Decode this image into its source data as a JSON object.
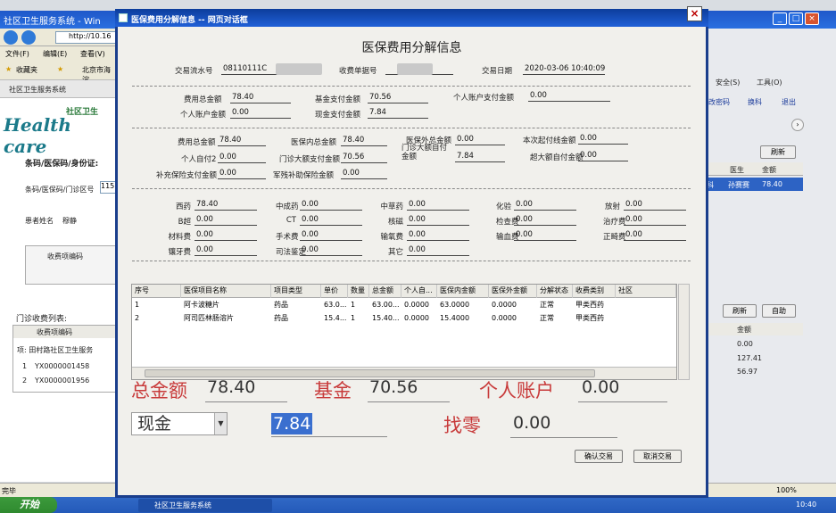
{
  "background": {
    "tab_title": "社区卫生服务系统 - Win",
    "address_value": "http://10.16",
    "menu": [
      "文件(F)",
      "编辑(E)",
      "查看(V)"
    ],
    "favorites": [
      "收藏夹",
      "北京市海淀"
    ],
    "page_tab": "社区卫生服务系统",
    "logo_text": "Health care",
    "logo_sub": "社区卫生",
    "patient_section_title": "条码/医保码/身份证:",
    "barcode_label": "条码/医保码/门诊区号",
    "barcode_value": "115",
    "patient_name_label": "患者姓名",
    "patient_name_value": "穆静",
    "fee_code_header": "收费项编码",
    "outpatient_list_title": "门诊收费列表:",
    "outpatient_list_header": "收费项编码",
    "outpatient_group": "项: 田村路社区卫生服务",
    "outpatient_rows": [
      {
        "num": "1",
        "code": "YX0000001458"
      },
      {
        "num": "2",
        "code": "YX0000001956"
      }
    ],
    "right_toolbar": [
      "安全(S)",
      "工具(O)"
    ],
    "right_links": [
      "改密码",
      "换科",
      "退出"
    ],
    "refresh_label": "刷新",
    "right_table_headers": [
      "医生",
      "金额"
    ],
    "right_table_row": [
      "科",
      "孙赛赛",
      "78.40"
    ],
    "right_buttons": [
      "刷新",
      "自助"
    ],
    "right_amount_header": "金额",
    "right_amounts": [
      "0.00",
      "127.41",
      "56.97"
    ],
    "status_left": "完毕",
    "zoom": "100%",
    "start_label": "开始",
    "task_item": "社区卫生服务系统",
    "clock": "10:40"
  },
  "dialog": {
    "window_title": "医保费用分解信息 -- 网页对话框",
    "heading": "医保费用分解信息",
    "trans_no_label": "交易流水号",
    "trans_no_value": "08110111C",
    "receipt_no_label": "收费单据号",
    "trans_date_label": "交易日期",
    "trans_date_value": "2020-03-06 10:40:09",
    "summary1": {
      "total_label": "费用总金额",
      "total_value": "78.40",
      "fund_label": "基金支付金额",
      "fund_value": "70.56",
      "personal_acct_label": "个人账户支付金额",
      "personal_acct_value": "0.00",
      "personal_label": "个人账户金额",
      "personal_value": "0.00",
      "cash_label": "现金支付金额",
      "cash_value": "7.84"
    },
    "summary2": {
      "total_label": "费用总金额",
      "total_value": "78.40",
      "in_ins_label": "医保内总金额",
      "in_ins_value": "78.40",
      "out_ins_label": "医保外总金额",
      "out_ins_value": "0.00",
      "start_line_label": "本次起付线金额",
      "start_line_value": "0.00",
      "self2_label": "个人自付2",
      "self2_value": "0.00",
      "large_pay_label": "门诊大额支付金额",
      "large_pay_value": "70.56",
      "large_self_label": "门诊大额自付金额",
      "large_self_value": "7.84",
      "over_large_label": "超大额自付金额",
      "over_large_value": "0.00",
      "supp_label": "补充保险支付金额",
      "supp_value": "0.00",
      "disab_label": "军残补助保险金额",
      "disab_value": "0.00"
    },
    "categories": [
      {
        "label": "西药",
        "value": "78.40"
      },
      {
        "label": "中成药",
        "value": "0.00"
      },
      {
        "label": "中草药",
        "value": "0.00"
      },
      {
        "label": "化验",
        "value": "0.00"
      },
      {
        "label": "放射",
        "value": "0.00"
      },
      {
        "label": "B超",
        "value": "0.00"
      },
      {
        "label": "CT",
        "value": "0.00"
      },
      {
        "label": "核磁",
        "value": "0.00"
      },
      {
        "label": "检查费",
        "value": "0.00"
      },
      {
        "label": "治疗费",
        "value": "0.00"
      },
      {
        "label": "材料费",
        "value": "0.00"
      },
      {
        "label": "手术费",
        "value": "0.00"
      },
      {
        "label": "输氧费",
        "value": "0.00"
      },
      {
        "label": "输血费",
        "value": "0.00"
      },
      {
        "label": "正畸费",
        "value": "0.00"
      },
      {
        "label": "镶牙费",
        "value": "0.00"
      },
      {
        "label": "司法鉴定",
        "value": "0.00"
      },
      {
        "label": "其它",
        "value": "0.00"
      }
    ],
    "table": {
      "headers": [
        "序号",
        "医保项目名称",
        "项目类型",
        "单价",
        "数量",
        "总金额",
        "个人自...",
        "医保内金额",
        "医保外金额",
        "分解状态",
        "收费类别",
        "社区"
      ],
      "rows": [
        [
          "1",
          "阿卡波糖片",
          "药品",
          "63.0...",
          "1",
          "63.00...",
          "0.0000",
          "63.0000",
          "0.0000",
          "正常",
          "甲类西药",
          ""
        ],
        [
          "2",
          "阿司匹林肠溶片",
          "药品",
          "15.4...",
          "1",
          "15.40...",
          "0.0000",
          "15.4000",
          "0.0000",
          "正常",
          "甲类西药",
          ""
        ]
      ]
    },
    "totals": {
      "total_label": "总金额",
      "total_value": "78.40",
      "fund_label": "基金",
      "fund_value": "70.56",
      "personal_label": "个人账户",
      "personal_value": "0.00",
      "pay_method": "现金",
      "cash_value": "7.84",
      "change_label": "找零",
      "change_value": "0.00"
    },
    "confirm_label": "确认交易",
    "cancel_label": "取消交易"
  }
}
